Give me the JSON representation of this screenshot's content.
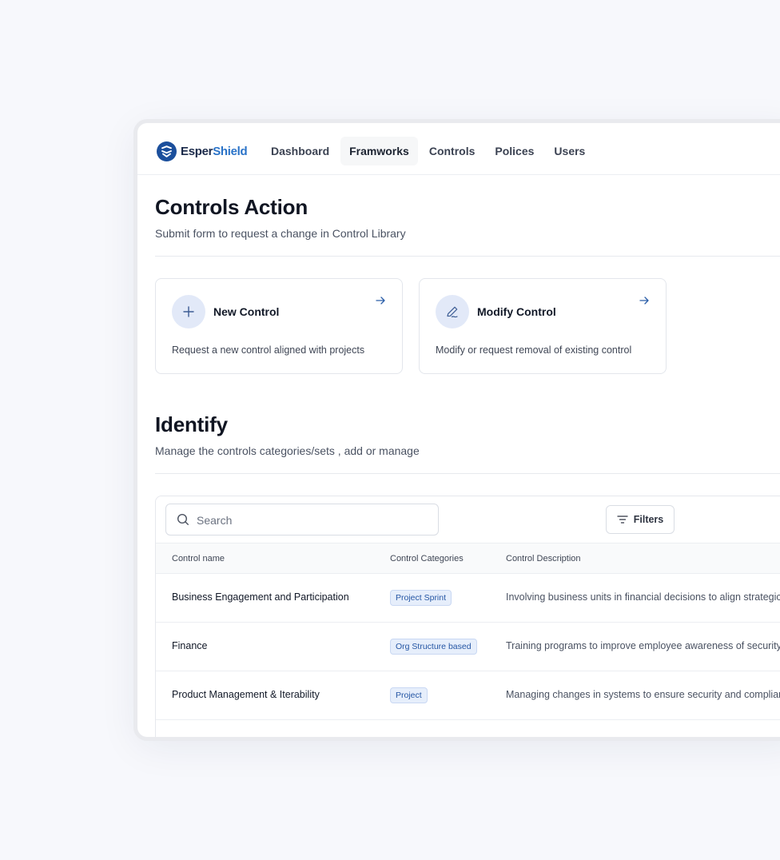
{
  "brand": {
    "part1": "Esper",
    "part2": "Shield",
    "color_dark": "#1b2a4a",
    "color_accent": "#2a73c8"
  },
  "nav": [
    {
      "label": "Dashboard",
      "active": false
    },
    {
      "label": "Framworks",
      "active": true
    },
    {
      "label": "Controls",
      "active": false
    },
    {
      "label": "Polices",
      "active": false
    },
    {
      "label": "Users",
      "active": false
    }
  ],
  "actions_section": {
    "title": "Controls Action",
    "subtitle": "Submit form to request a change in Control Library",
    "cards": [
      {
        "icon": "plus-icon",
        "title": "New Control",
        "description": "Request a new control aligned with projects"
      },
      {
        "icon": "pen-icon",
        "title": "Modify Control",
        "description": "Modify or request removal of existing control"
      }
    ]
  },
  "identify_section": {
    "title": "Identify",
    "subtitle": "Manage the controls categories/sets , add or manage"
  },
  "table": {
    "search_placeholder": "Search",
    "filters_label": "Filters",
    "columns": [
      "Control name",
      "Control Categories",
      "Control Description"
    ],
    "rows": [
      {
        "name": "Business Engagement and Participation",
        "category": "Project Sprint",
        "description": "Involving business units in financial decisions to align strategic goals"
      },
      {
        "name": "Finance",
        "category": "Org Structure based",
        "description": "Training programs to improve employee awareness of security practices"
      },
      {
        "name": "Product Management & Iterability",
        "category": "Project",
        "description": "Managing changes in systems to ensure security and compliance"
      }
    ]
  }
}
